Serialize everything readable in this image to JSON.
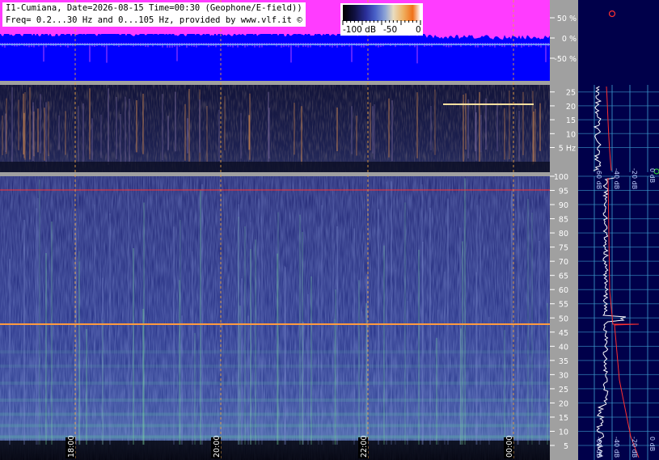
{
  "header": {
    "line1": "I1-Cumiana, Date=2026-08-15 Time=00:30 (Geophone/E-field))",
    "line2": "Freq= 0.2...30 Hz and 0...105 Hz, provided by www.vlf.it ©"
  },
  "colorbar": {
    "label_min": "-100 dB",
    "label_mid": "-50",
    "label_max": "0"
  },
  "colors": {
    "blue_panel": "#0000ff",
    "magenta": "#ff3cff",
    "axis_gray": "#a0a0a0",
    "side_panel": "#00004a",
    "grid_line": "#3f9fd0",
    "marker_red": "#ff3030",
    "trace_white": "#ffffff",
    "cursor_orange": "#e8a040"
  },
  "chart_data": [
    {
      "type": "area",
      "description_panel": "amplitude",
      "y_ticks": [
        "50 %",
        "0 %",
        "-50 %"
      ],
      "ylim": [
        -100,
        100
      ]
    },
    {
      "type": "heatmap",
      "description_panel": "low-frequency spectrogram",
      "y_ticks": [
        "25",
        "20",
        "15",
        "10",
        "5 Hz"
      ],
      "ylim": [
        0.2,
        30
      ],
      "x_ticks": [
        "18:00",
        "20:00",
        "22:00",
        "00:00"
      ],
      "side_scale_labels": [
        "-60 dB",
        "-40 dB",
        "-20 dB",
        "0 dB"
      ]
    },
    {
      "type": "heatmap",
      "description_panel": "main spectrogram",
      "y_ticks": [
        "100",
        "95",
        "90",
        "85",
        "80",
        "75",
        "70",
        "65",
        "60",
        "55",
        "50",
        "45",
        "40",
        "35",
        "30",
        "25",
        "20",
        "15",
        "10",
        "5"
      ],
      "ylim": [
        0,
        105
      ],
      "x_ticks": [
        "18:00",
        "20:00",
        "22:00",
        "00:00"
      ],
      "side_scale_labels": [
        "-60 dB",
        "-40 dB",
        "-20 dB",
        "0 dB"
      ],
      "persistent_lines_hz": [
        50,
        100
      ]
    }
  ]
}
